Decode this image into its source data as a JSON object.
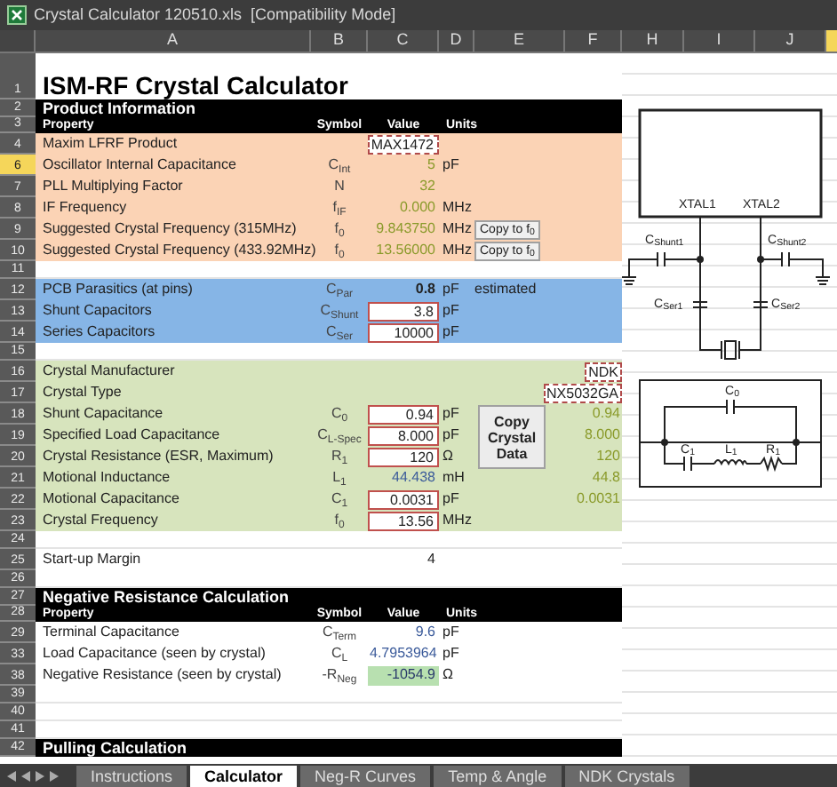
{
  "window": {
    "title": "Crystal Calculator 120510.xls  [Compatibility Mode]"
  },
  "columns": [
    {
      "label": "A"
    },
    {
      "label": "B"
    },
    {
      "label": "C"
    },
    {
      "label": "D"
    },
    {
      "label": "E"
    },
    {
      "label": "F"
    },
    {
      "label": "H"
    },
    {
      "label": "I"
    },
    {
      "label": "J"
    }
  ],
  "rows": [
    {
      "num": "1",
      "kind": "title",
      "selected": false,
      "text": "ISM-RF Crystal Calculator"
    },
    {
      "num": "2",
      "kind": "section",
      "selected": false,
      "text": "Product Information"
    },
    {
      "num": "3",
      "kind": "columns",
      "selected": false,
      "labels": [
        "Property",
        "Symbol",
        "Value",
        "Units"
      ]
    },
    {
      "num": "4",
      "kind": "data",
      "color": "#fbd3b5",
      "selected": false,
      "property": "Maxim LFRF Product",
      "value": {
        "text": "MAX1472",
        "kind": "selector"
      }
    },
    {
      "num": "6",
      "kind": "data",
      "color": "#fbd3b5",
      "selected": true,
      "property": "Oscillator Internal Capacitance",
      "symbol": "C$_{Int}$",
      "value": {
        "text": "5",
        "kind": "computed"
      },
      "unit": "pF"
    },
    {
      "num": "7",
      "kind": "data",
      "color": "#fbd3b5",
      "selected": false,
      "property": "PLL Multiplying Factor",
      "symbol": "N",
      "value": {
        "text": "32",
        "kind": "computed"
      }
    },
    {
      "num": "8",
      "kind": "data",
      "color": "#fbd3b5",
      "selected": false,
      "property": "IF Frequency",
      "symbol": "f$_{IF}$",
      "value": {
        "text": "0.000",
        "kind": "computed"
      },
      "unit": "MHz"
    },
    {
      "num": "9",
      "kind": "data",
      "color": "#fbd3b5",
      "selected": false,
      "property": "Suggested Crystal Frequency (315MHz)",
      "symbol": "f$_{0}$",
      "value": {
        "text": "9.843750",
        "kind": "computed"
      },
      "unit": "MHz",
      "button": "Copy to f$_{0}$"
    },
    {
      "num": "10",
      "kind": "data",
      "color": "#fbd3b5",
      "selected": false,
      "property": "Suggested Crystal Frequency (433.92MHz)",
      "symbol": "f$_{0}$",
      "value": {
        "text": "13.56000",
        "kind": "computed"
      },
      "unit": "MHz",
      "button": "Copy to f$_{0}$"
    },
    {
      "num": "11",
      "kind": "blank",
      "selected": false
    },
    {
      "num": "12",
      "kind": "data",
      "color": "#86b5e6",
      "selected": false,
      "property": "PCB Parasitics (at pins)",
      "symbol": "C$_{Par}$",
      "value": {
        "text": "0.8",
        "kind": "bold"
      },
      "unit": "pF",
      "note": "estimated"
    },
    {
      "num": "13",
      "kind": "data",
      "color": "#86b5e6",
      "selected": false,
      "property": "Shunt Capacitors",
      "symbol": "C$_{Shunt}$",
      "value": {
        "text": "3.8",
        "kind": "input"
      },
      "unit": "pF"
    },
    {
      "num": "14",
      "kind": "data",
      "color": "#86b5e6",
      "selected": false,
      "property": "Series Capacitors",
      "symbol": "C$_{Ser}$",
      "value": {
        "text": "10000",
        "kind": "input"
      },
      "unit": "pF"
    },
    {
      "num": "15",
      "kind": "blank",
      "selected": false
    },
    {
      "num": "16",
      "kind": "data",
      "color": "#d7e4bd",
      "selected": false,
      "property": "Crystal Manufacturer",
      "f_value": {
        "text": "NDK",
        "kind": "selector"
      }
    },
    {
      "num": "17",
      "kind": "data",
      "color": "#d7e4bd",
      "selected": false,
      "property": "Crystal Type",
      "f_value": {
        "text": "NX5032GA",
        "kind": "selector"
      }
    },
    {
      "num": "18",
      "kind": "data",
      "color": "#d7e4bd",
      "selected": false,
      "property": "Shunt Capacitance",
      "symbol": "C$_{0}$",
      "value": {
        "text": "0.94",
        "kind": "input"
      },
      "unit": "pF",
      "f_value": {
        "text": "0.94",
        "kind": "computed"
      },
      "big_button": "Copy Crystal Data"
    },
    {
      "num": "19",
      "kind": "data",
      "color": "#d7e4bd",
      "selected": false,
      "property": "Specified Load Capacitance",
      "symbol": "C$_{L-Spec}$",
      "value": {
        "text": "8.000",
        "kind": "input"
      },
      "unit": "pF",
      "f_value": {
        "text": "8.000",
        "kind": "computed"
      }
    },
    {
      "num": "20",
      "kind": "data",
      "color": "#d7e4bd",
      "selected": false,
      "property": "Crystal Resistance (ESR, Maximum)",
      "symbol": "R$_{1}$",
      "value": {
        "text": "120",
        "kind": "input"
      },
      "unit": "Ω",
      "f_value": {
        "text": "120",
        "kind": "computed"
      }
    },
    {
      "num": "21",
      "kind": "data",
      "color": "#d7e4bd",
      "selected": false,
      "property": "Motional Inductance",
      "symbol": "L$_{1}$",
      "value": {
        "text": "44.438",
        "kind": "derived"
      },
      "unit": "mH",
      "f_value": {
        "text": "44.8",
        "kind": "computed"
      }
    },
    {
      "num": "22",
      "kind": "data",
      "color": "#d7e4bd",
      "selected": false,
      "property": "Motional Capacitance",
      "symbol": "C$_{1}$",
      "value": {
        "text": "0.0031",
        "kind": "input"
      },
      "unit": "pF",
      "f_value": {
        "text": "0.0031",
        "kind": "computed"
      }
    },
    {
      "num": "23",
      "kind": "data",
      "color": "#d7e4bd",
      "selected": false,
      "property": "Crystal Frequency",
      "symbol": "f$_{0}$",
      "value": {
        "text": "13.56",
        "kind": "input"
      },
      "unit": "MHz"
    },
    {
      "num": "24",
      "kind": "blank",
      "selected": false
    },
    {
      "num": "25",
      "kind": "data",
      "selected": false,
      "property": "Start-up Margin",
      "value": {
        "text": "4",
        "kind": "plain"
      }
    },
    {
      "num": "26",
      "kind": "blank",
      "selected": false
    },
    {
      "num": "27",
      "kind": "section",
      "selected": false,
      "text": "Negative Resistance Calculation"
    },
    {
      "num": "28",
      "kind": "columns",
      "selected": false,
      "labels": [
        "Property",
        "Symbol",
        "Value",
        "Units"
      ]
    },
    {
      "num": "29",
      "kind": "data",
      "selected": false,
      "property": "Terminal Capacitance",
      "symbol": "C$_{Term}$",
      "value": {
        "text": "9.6",
        "kind": "derived"
      },
      "unit": "pF"
    },
    {
      "num": "33",
      "kind": "data",
      "selected": false,
      "property": "Load Capacitance (seen by crystal)",
      "symbol": "C$_{L}$",
      "value": {
        "text": "4.7953964",
        "kind": "derived"
      },
      "unit": "pF"
    },
    {
      "num": "38",
      "kind": "data",
      "selected": false,
      "property": "Negative Resistance (seen by crystal)",
      "symbol": "-R$_{Neg}$",
      "value": {
        "text": "-1054.9",
        "kind": "result"
      },
      "unit": "Ω"
    },
    {
      "num": "39",
      "kind": "blank",
      "selected": false
    },
    {
      "num": "40",
      "kind": "blank",
      "selected": false
    },
    {
      "num": "41",
      "kind": "blank",
      "selected": false
    },
    {
      "num": "42",
      "kind": "section",
      "selected": false,
      "text": "Pulling Calculation"
    }
  ],
  "diagram_labels": {
    "xtal1": "XTAL1",
    "xtal2": "XTAL2",
    "shunt1": "C$_{Shunt1}$",
    "shunt2": "C$_{Shunt2}$",
    "ser1": "C$_{Ser1}$",
    "ser2": "C$_{Ser2}$",
    "c0": "C$_{0}$",
    "c1": "C$_{1}$",
    "l1": "L$_{1}$",
    "r1": "R$_{1}$"
  },
  "sheet_tabs": [
    {
      "label": "Instructions",
      "selected": false
    },
    {
      "label": "Calculator",
      "selected": true
    },
    {
      "label": "Neg-R Curves",
      "selected": false
    },
    {
      "label": "Temp & Angle",
      "selected": false
    },
    {
      "label": "NDK Crystals",
      "selected": false
    }
  ]
}
